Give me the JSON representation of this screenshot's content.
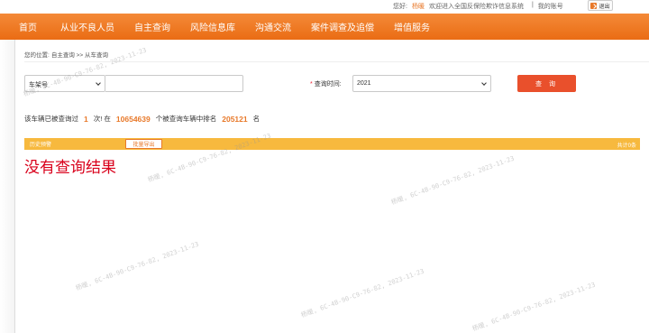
{
  "topbar": {
    "greeting": "您好:",
    "username": "杨暖",
    "welcome": "欢迎进入全国反保险欺诈信息系统",
    "divider": "|",
    "my_account": "我的账号",
    "logout": "退出"
  },
  "nav": {
    "items": [
      "首页",
      "从业不良人员",
      "自主查询",
      "风险信息库",
      "沟通交流",
      "案件调查及追偿",
      "增值服务"
    ]
  },
  "breadcrumb": {
    "location_label": "您的位置:",
    "path": "自主查询 >> 从车查询"
  },
  "filter": {
    "field_type": "车架号",
    "field_value": "",
    "query_time_label": "查询时间:",
    "query_time_required": "*",
    "year": "2021",
    "search_button": "查 询"
  },
  "stats": {
    "prefix": "该车辆已被查询过",
    "times": "1",
    "mid1": "次! 在",
    "total_vehicles": "10654639",
    "mid2": "个被查询车辆中排名",
    "rank": "205121",
    "suffix": "名"
  },
  "results": {
    "title": "历史预警",
    "export_button": "批量导出",
    "total": "共计0条",
    "empty_message": "没有查询结果"
  },
  "watermark": {
    "text": "杨暖, 6C-4B-90-C9-76-82, 2023-11-23"
  },
  "colors": {
    "nav_orange": "#ea6c14",
    "results_bar": "#f7b93e",
    "search_button": "#e9502c",
    "highlight_number": "#e8792a",
    "empty_message": "#d9001b"
  }
}
